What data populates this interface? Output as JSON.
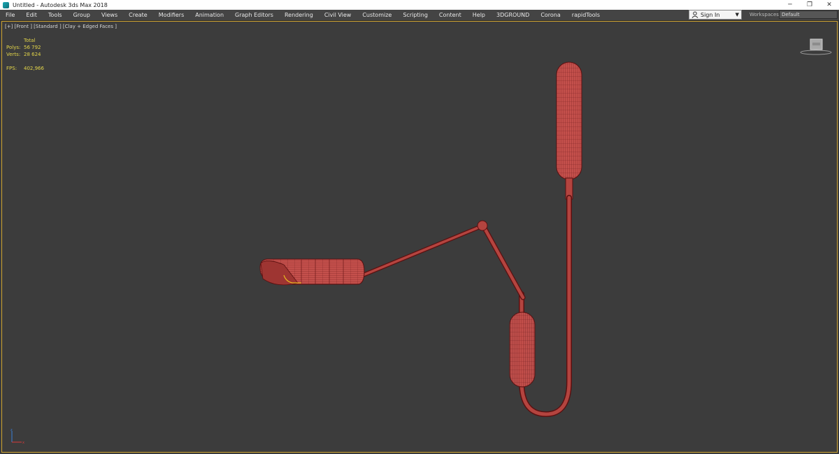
{
  "window": {
    "title": "Untitled - Autodesk 3ds Max 2018",
    "controls": {
      "minimize": "─",
      "restore": "❐",
      "close": "✕"
    }
  },
  "menu": [
    "File",
    "Edit",
    "Tools",
    "Group",
    "Views",
    "Create",
    "Modifiers",
    "Animation",
    "Graph Editors",
    "Rendering",
    "Civil View",
    "Customize",
    "Scripting",
    "Content",
    "Help",
    "3DGROUND",
    "Corona",
    "rapidTools"
  ],
  "account": {
    "signin_label": "Sign In",
    "dropdown_arrow": "▼"
  },
  "workspaces": {
    "label": "Workspaces:",
    "value": "Default"
  },
  "viewport": {
    "label": "[+] [Front ] [Standard ] [Clay + Edged Faces ]",
    "stats": {
      "header": "Total",
      "polys_label": "Polys:",
      "polys_value": "56 792",
      "verts_label": "Verts:",
      "verts_value": "28 624",
      "fps_label": "FPS:",
      "fps_value": "402,966"
    }
  },
  "colors": {
    "accent": "#cfa430",
    "viewport_bg": "#3c3c3c",
    "menubar_bg": "#444444",
    "model": "#c4504c",
    "wire": "#5a1010"
  }
}
